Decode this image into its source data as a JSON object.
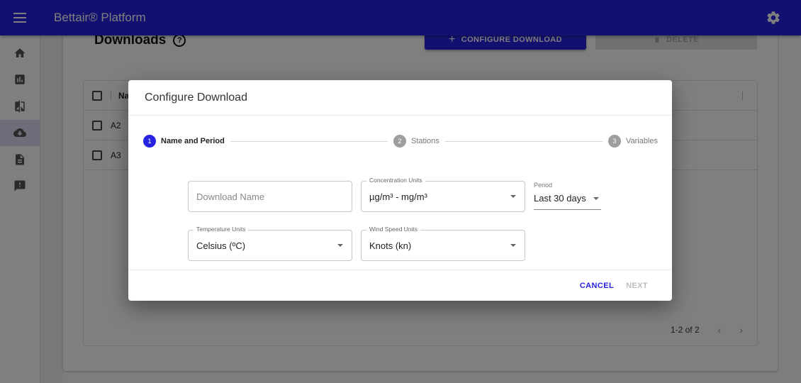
{
  "appbar": {
    "title": "Bettair® Platform",
    "menu_icon": "hamburger-menu-icon",
    "settings_icon": "gear-icon"
  },
  "sidebar": {
    "items": [
      {
        "icon": "home-icon",
        "active": false
      },
      {
        "icon": "bar-chart-icon",
        "active": false
      },
      {
        "icon": "compare-icon",
        "active": false
      },
      {
        "icon": "cloud-download-icon",
        "active": true
      },
      {
        "icon": "document-icon",
        "active": false
      },
      {
        "icon": "feedback-icon",
        "active": false
      }
    ]
  },
  "page": {
    "title": "Downloads",
    "help_icon": "?",
    "configure_button": "CONFIGURE DOWNLOAD",
    "configure_icon": "+",
    "delete_button": "DELETE",
    "table": {
      "header": "Na",
      "rows": [
        {
          "name": "A2"
        },
        {
          "name": "A3"
        }
      ]
    },
    "pagination": {
      "range": "1-2 of 2",
      "prev": "‹",
      "next": "›"
    }
  },
  "dialog": {
    "title": "Configure Download",
    "steps": [
      {
        "number": "1",
        "label": "Name and Period",
        "state": "active"
      },
      {
        "number": "2",
        "label": "Stations",
        "state": "inactive"
      },
      {
        "number": "3",
        "label": "Variables",
        "state": "inactive"
      }
    ],
    "fields": {
      "download_name": {
        "placeholder": "Download Name",
        "value": ""
      },
      "concentration_units": {
        "label": "Concentration Units",
        "value": "µg/m³ - mg/m³"
      },
      "period": {
        "label": "Period",
        "value": "Last 30 days"
      },
      "temperature_units": {
        "label": "Temperature Units",
        "value": "Celsius (ºC)"
      },
      "wind_speed_units": {
        "label": "Wind Speed Units",
        "value": "Knots (kn)"
      }
    },
    "actions": {
      "cancel": "CANCEL",
      "next": "NEXT"
    }
  },
  "colors": {
    "primary": "#2723e0",
    "disabled": "#bdbdbd"
  }
}
